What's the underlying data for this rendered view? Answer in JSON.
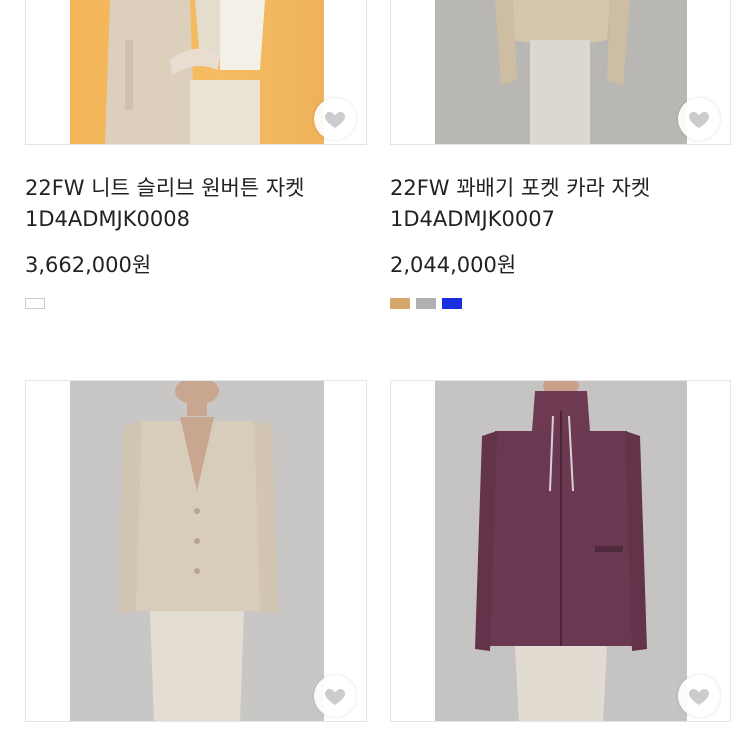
{
  "products": [
    {
      "title": "22FW 니트 슬리브 원버튼 자켓",
      "code": "1D4ADMJK0008",
      "price": "3,662,000원",
      "image_desc": "beige wool jacket with knit sleeves, orange background",
      "swatches": [
        "#ffffff"
      ]
    },
    {
      "title": "22FW 꽈배기 포켓 카라 자켓",
      "code": "1D4ADMJK0007",
      "price": "2,044,000원",
      "image_desc": "cable knit beige cardigan jacket",
      "swatches": [
        "#d4a86a",
        "#b0b0b0",
        "#1a2fe0"
      ]
    },
    {
      "title": "",
      "code": "",
      "price": "",
      "image_desc": "beige knit collared cardigan",
      "swatches": []
    },
    {
      "title": "",
      "code": "",
      "price": "",
      "image_desc": "plum purple knit zip jacket with funnel neck",
      "swatches": []
    }
  ],
  "icons": {
    "wishlist": "heart-icon"
  },
  "colors": {
    "border": "#e4e4e4",
    "heart": "#cccccc"
  }
}
